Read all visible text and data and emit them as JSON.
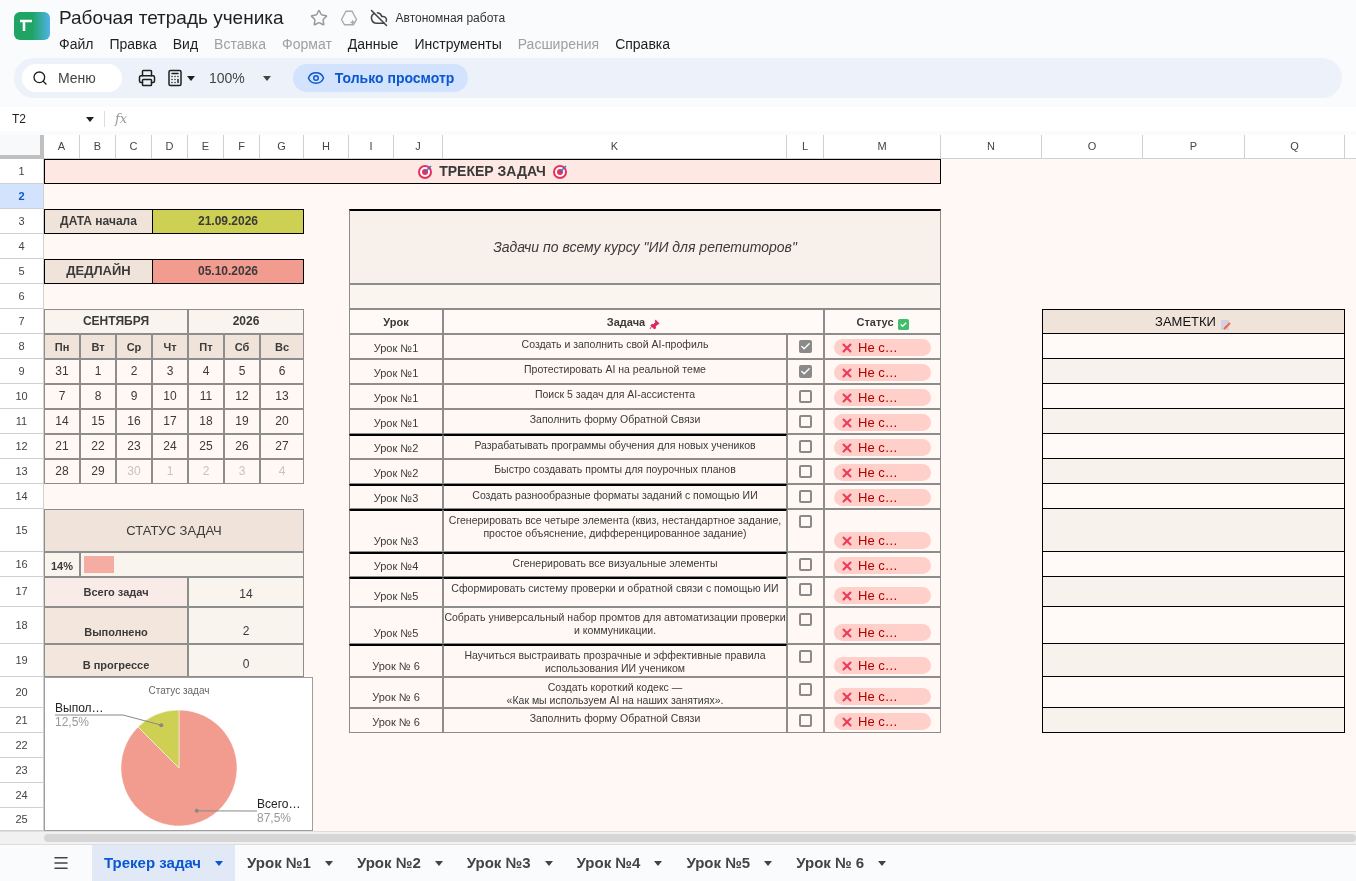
{
  "app": {
    "title": "Рабочая тетрадь ученика",
    "status": "Автономная работа"
  },
  "menu": [
    {
      "label": "Файл",
      "disabled": false
    },
    {
      "label": "Правка",
      "disabled": false
    },
    {
      "label": "Вид",
      "disabled": false
    },
    {
      "label": "Вставка",
      "disabled": true
    },
    {
      "label": "Формат",
      "disabled": true
    },
    {
      "label": "Данные",
      "disabled": false
    },
    {
      "label": "Инструменты",
      "disabled": false
    },
    {
      "label": "Расширения",
      "disabled": true
    },
    {
      "label": "Справка",
      "disabled": false
    }
  ],
  "toolbar": {
    "search_label": "Меню",
    "zoom": "100%",
    "mode": "Только просмотр"
  },
  "formula_bar": {
    "cell": "T2",
    "fx": "fx"
  },
  "columns": [
    "A",
    "B",
    "C",
    "D",
    "E",
    "F",
    "G",
    "H",
    "I",
    "J",
    "K",
    "L",
    "M",
    "N",
    "O",
    "P",
    "Q"
  ],
  "rows": [
    {
      "label": "1",
      "selected": false
    },
    {
      "label": "2",
      "selected": true
    },
    {
      "label": "3",
      "selected": false
    },
    {
      "label": "4",
      "selected": false
    },
    {
      "label": "5",
      "selected": false
    },
    {
      "label": "6",
      "selected": false
    },
    {
      "label": "7",
      "selected": false
    },
    {
      "label": "8",
      "selected": false
    },
    {
      "label": "9",
      "selected": false
    },
    {
      "label": "10",
      "selected": false
    },
    {
      "label": "11",
      "selected": false
    },
    {
      "label": "12",
      "selected": false
    },
    {
      "label": "13",
      "selected": false
    },
    {
      "label": "14",
      "selected": false
    },
    {
      "label": "15",
      "selected": false
    },
    {
      "label": "16",
      "selected": false
    },
    {
      "label": "17",
      "selected": false
    },
    {
      "label": "18",
      "selected": false
    },
    {
      "label": "19",
      "selected": false
    },
    {
      "label": "20",
      "selected": false
    },
    {
      "label": "21",
      "selected": false
    },
    {
      "label": "22",
      "selected": false
    },
    {
      "label": "23",
      "selected": false
    },
    {
      "label": "24",
      "selected": false
    },
    {
      "label": "25",
      "selected": false
    }
  ],
  "sheet": {
    "title": "ТРЕКЕР ЗАДАЧ",
    "start_date": {
      "label": "ДАТА начала",
      "value": "21.09.2026"
    },
    "deadline": {
      "label": "ДЕДЛАЙН",
      "value": "05.10.2026"
    },
    "calendar": {
      "month": "СЕНТЯБРЯ",
      "year": "2026",
      "weekdays": [
        "Пн",
        "Вт",
        "Ср",
        "Чт",
        "Пт",
        "Сб",
        "Вс"
      ],
      "weeks": [
        [
          {
            "day": "31",
            "muted": false
          },
          {
            "day": "1",
            "muted": false
          },
          {
            "day": "2",
            "muted": false
          },
          {
            "day": "3",
            "muted": false
          },
          {
            "day": "4",
            "muted": false
          },
          {
            "day": "5",
            "muted": false
          },
          {
            "day": "6",
            "muted": false
          }
        ],
        [
          {
            "day": "7",
            "muted": false
          },
          {
            "day": "8",
            "muted": false
          },
          {
            "day": "9",
            "muted": false
          },
          {
            "day": "10",
            "muted": false
          },
          {
            "day": "11",
            "muted": false
          },
          {
            "day": "12",
            "muted": false
          },
          {
            "day": "13",
            "muted": false
          }
        ],
        [
          {
            "day": "14",
            "muted": false
          },
          {
            "day": "15",
            "muted": false
          },
          {
            "day": "16",
            "muted": false
          },
          {
            "day": "17",
            "muted": false
          },
          {
            "day": "18",
            "muted": false
          },
          {
            "day": "19",
            "muted": false
          },
          {
            "day": "20",
            "muted": false
          }
        ],
        [
          {
            "day": "21",
            "muted": false
          },
          {
            "day": "22",
            "muted": false
          },
          {
            "day": "23",
            "muted": false
          },
          {
            "day": "24",
            "muted": false
          },
          {
            "day": "25",
            "muted": false
          },
          {
            "day": "26",
            "muted": false
          },
          {
            "day": "27",
            "muted": false
          }
        ],
        [
          {
            "day": "28",
            "muted": false
          },
          {
            "day": "29",
            "muted": false
          },
          {
            "day": "30",
            "muted": true
          },
          {
            "day": "1",
            "muted": true
          },
          {
            "day": "2",
            "muted": true
          },
          {
            "day": "3",
            "muted": true
          },
          {
            "day": "4",
            "muted": true
          }
        ]
      ]
    },
    "status": {
      "title": "СТАТУС ЗАДАЧ",
      "percent": "14%",
      "level": 0.14,
      "stats": [
        {
          "label": "Всего задач",
          "value": "14"
        },
        {
          "label": "Выполнено",
          "value": "2"
        },
        {
          "label": "В прогрессе",
          "value": "0"
        }
      ]
    },
    "chart_data": {
      "type": "pie",
      "title": "Статус задач",
      "categories": [
        "Всего…",
        "Выпол…"
      ],
      "colors": [
        "#f29b8f",
        "#cdd052"
      ],
      "values": [
        87.5,
        12.5
      ],
      "value_labels": [
        "87,5%",
        "12,5%"
      ]
    },
    "tasks": {
      "heading": "Задачи по всему курсу \"ИИ для репетиторов\"",
      "columns": [
        "Урок",
        "Задача",
        "Статус"
      ],
      "rows": [
        {
          "lesson": "Урок №1",
          "task": "Создать и заполнить свой AI-профиль",
          "done": true,
          "status": "Не с…",
          "group_start": false
        },
        {
          "lesson": "Урок №1",
          "task": "Протестировать AI на реальной теме",
          "done": true,
          "status": "Не с…",
          "group_start": false
        },
        {
          "lesson": "Урок №1",
          "task": "Поиск 5 задач для AI-ассистента",
          "done": false,
          "status": "Не с…",
          "group_start": false
        },
        {
          "lesson": "Урок №1",
          "task": "Заполнить форму Обратной Связи",
          "done": false,
          "status": "Не с…",
          "group_start": false
        },
        {
          "lesson": "Урок №2",
          "task": "Разрабатывать программы обучения для новых учеников",
          "done": false,
          "status": "Не с…",
          "group_start": true
        },
        {
          "lesson": "Урок №2",
          "task": "Быстро создавать промты для поурочных планов",
          "done": false,
          "status": "Не с…",
          "group_start": false
        },
        {
          "lesson": "Урок №3",
          "task": "Создать разнообразные форматы заданий с помощью ИИ",
          "done": false,
          "status": "Не с…",
          "group_start": true
        },
        {
          "lesson": "Урок №3",
          "task": "Сгенерировать все четыре элемента (квиз, нестандартное задание, простое объяснение, дифференцированное задание)",
          "done": false,
          "status": "Не с…",
          "group_start": true
        },
        {
          "lesson": "Урок №4",
          "task": "Сгенерировать все визуальные элементы",
          "done": false,
          "status": "Не с…",
          "group_start": true
        },
        {
          "lesson": "Урок №5",
          "task": "Сформировать систему проверки и обратной связи с помощью ИИ",
          "done": false,
          "status": "Не с…",
          "group_start": true
        },
        {
          "lesson": "Урок №5",
          "task": "Собрать универсальный набор промтов для автоматизации проверки и коммуникации.",
          "done": false,
          "status": "Не с…",
          "group_start": false
        },
        {
          "lesson": "Урок № 6",
          "task": "Научиться выстраивать прозрачные и эффективные правила использования ИИ учеником",
          "done": false,
          "status": "Не с…",
          "group_start": true
        },
        {
          "lesson": "Урок № 6",
          "task": "Создать короткий кодекс —\n«Как мы используем AI на наших занятиях».",
          "done": false,
          "status": "Не с…",
          "group_start": false
        },
        {
          "lesson": "Урок № 6",
          "task": "Заполнить форму Обратной Связи",
          "done": false,
          "status": "Не с…",
          "group_start": false
        }
      ]
    },
    "notes": {
      "title": "ЗАМЕТКИ"
    }
  },
  "tabs": [
    {
      "label": "Трекер задач",
      "selected": true
    },
    {
      "label": "Урок №1",
      "selected": false
    },
    {
      "label": "Урок №2",
      "selected": false
    },
    {
      "label": "Урок №3",
      "selected": false
    },
    {
      "label": "Урок №4",
      "selected": false
    },
    {
      "label": "Урок №5",
      "selected": false
    },
    {
      "label": "Урок № 6",
      "selected": false
    }
  ]
}
